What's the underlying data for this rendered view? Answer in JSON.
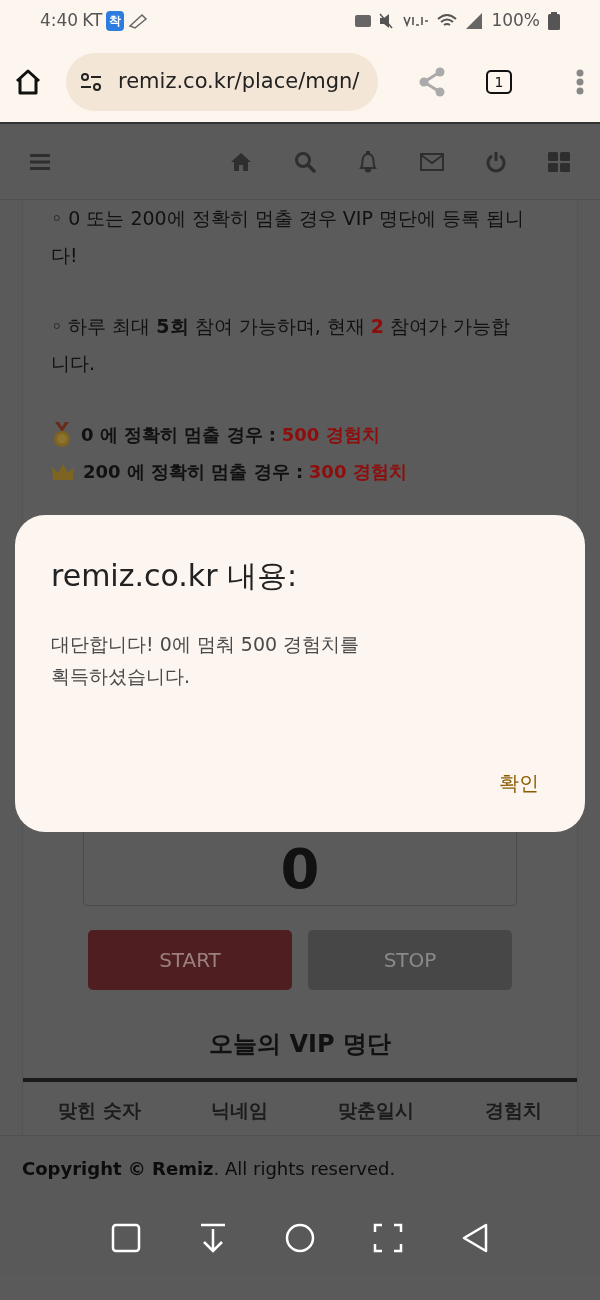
{
  "status_bar": {
    "time": "4:40",
    "carrier": "KT",
    "carrier_badge": "착",
    "battery": "100%"
  },
  "browser": {
    "url": "remiz.co.kr/place/mgn/",
    "tab_count": "1"
  },
  "paragraphs": [
    {
      "segments": [
        {
          "text": "◦ 0 또는 200에 정확히 멈출 경우 VIP 명단에 등록 됩니다!",
          "highlighted": false
        }
      ]
    },
    {
      "segments": [
        {
          "text": "◦ 하루 최대 **5회** 참여 가능하며, 현재 ",
          "highlighted": false
        },
        {
          "text": "2",
          "highlighted": true
        },
        {
          "text": " 참여가 가능합니다.",
          "highlighted": false
        }
      ]
    }
  ],
  "prizes": [
    {
      "kind": "medal",
      "segments": [
        {
          "text": "**0 에 정확히 멈출 경우 :** ",
          "highlighted": false
        },
        {
          "text": "500 경험치",
          "highlighted": true
        }
      ]
    },
    {
      "kind": "crown",
      "segments": [
        {
          "text": "**200 에 정확히 멈출 경우 :** ",
          "highlighted": false
        },
        {
          "text": "300 경험치",
          "highlighted": true
        }
      ]
    }
  ],
  "counter": "0",
  "buttons": [
    {
      "label": "START",
      "disabled": false
    },
    {
      "label": "STOP",
      "disabled": true
    }
  ],
  "vip_title": "오늘의 VIP 명단",
  "table": {
    "columns": [
      "맞힌 숫자",
      "닉네임",
      "맞춘일시",
      "경험치"
    ]
  },
  "footer": "**Copyright © Remiz**. All rights reserved.",
  "dialog": {
    "title": "remiz.co.kr 내용:",
    "message": "대단합니다! 0에 멈춰 500 경험치를\n획득하셨습니다.",
    "confirm": "확인"
  }
}
